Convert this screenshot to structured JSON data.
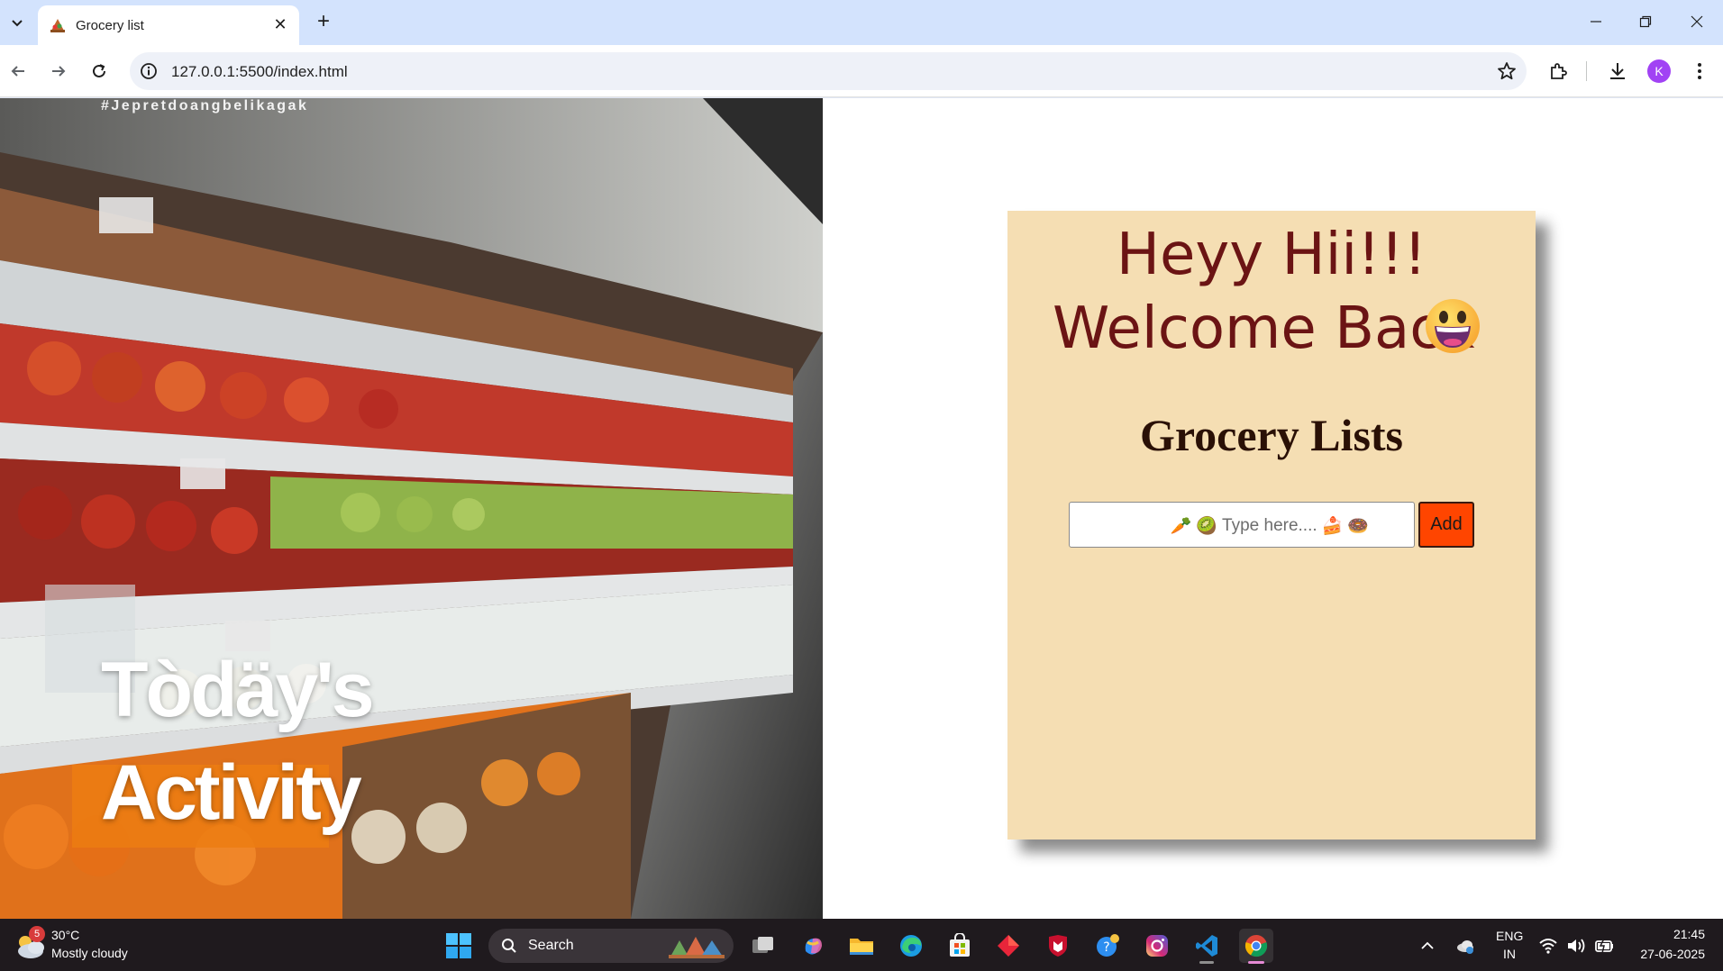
{
  "browser": {
    "tab_title": "Grocery list",
    "url": "127.0.0.1:5500/index.html",
    "profile_initial": "K"
  },
  "hero": {
    "watermark": "#Jepretdoangbelikagak",
    "title_line1": "Tòdäy's",
    "title_line2": "Activity"
  },
  "card": {
    "greeting_line1": "Heyy Hii!!!",
    "greeting_line2": "Welcome Back",
    "heading": "Grocery Lists",
    "input_placeholder": "Type here....",
    "input_value": "",
    "add_label": "Add"
  },
  "taskbar": {
    "weather_badge": "5",
    "temperature": "30°C",
    "condition": "Mostly cloudy",
    "search_label": "Search",
    "lang_line1": "ENG",
    "lang_line2": "IN",
    "time": "21:45",
    "date": "27-06-2025"
  },
  "colors": {
    "card_bg": "#f5deb3",
    "greeting_text": "#6b1414",
    "add_button": "#ff4500",
    "tabbar_bg": "#d3e3fd",
    "taskbar_bg": "#1f1a1e"
  }
}
